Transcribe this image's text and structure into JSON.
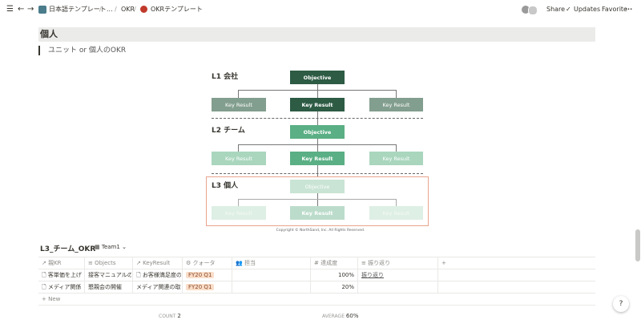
{
  "topbar": {
    "menu_icon": "menu-icon",
    "back_icon": "arrow-left-icon",
    "forward_icon": "arrow-right-icon",
    "breadcrumb": [
      "日本語テンプレート",
      "...",
      "OKR",
      "OKRテンプレート"
    ],
    "share": "Share",
    "updates": "Updates",
    "favorite": "Favorite",
    "more": "···"
  },
  "page": {
    "heading": "個人",
    "quote": "ユニット or 個人のOKR"
  },
  "diagram": {
    "levels": [
      "L1 会社",
      "L2 チーム",
      "L3 個人"
    ],
    "objective": "Objective",
    "key_result": "Key Result",
    "copyright": "Copyright © NorthSand, Inc. All Rights Reserved."
  },
  "database": {
    "title": "L3_チーム_OKR",
    "view": "Team1",
    "columns": [
      "親KR",
      "Objects",
      "KeyResult",
      "クォータ",
      "担当",
      "達成度",
      "振り返り",
      "+"
    ],
    "rows": [
      {
        "parent_kr": "客単価を上げ",
        "objects": "接客マニュアルの",
        "key_result": "お客様満足度の",
        "quarter": "FY20 Q1",
        "owner": "",
        "progress": "100%",
        "review": "振り返り"
      },
      {
        "parent_kr": "メディア関係",
        "objects": "懇親会の開催",
        "key_result": "メディア関連の取材",
        "quarter": "FY20 Q1",
        "owner": "",
        "progress": "20%",
        "review": ""
      }
    ],
    "new_label": "+ New",
    "count_label": "COUNT",
    "count_value": "2",
    "average_label": "AVERAGE",
    "average_value": "60%"
  },
  "help": "?"
}
